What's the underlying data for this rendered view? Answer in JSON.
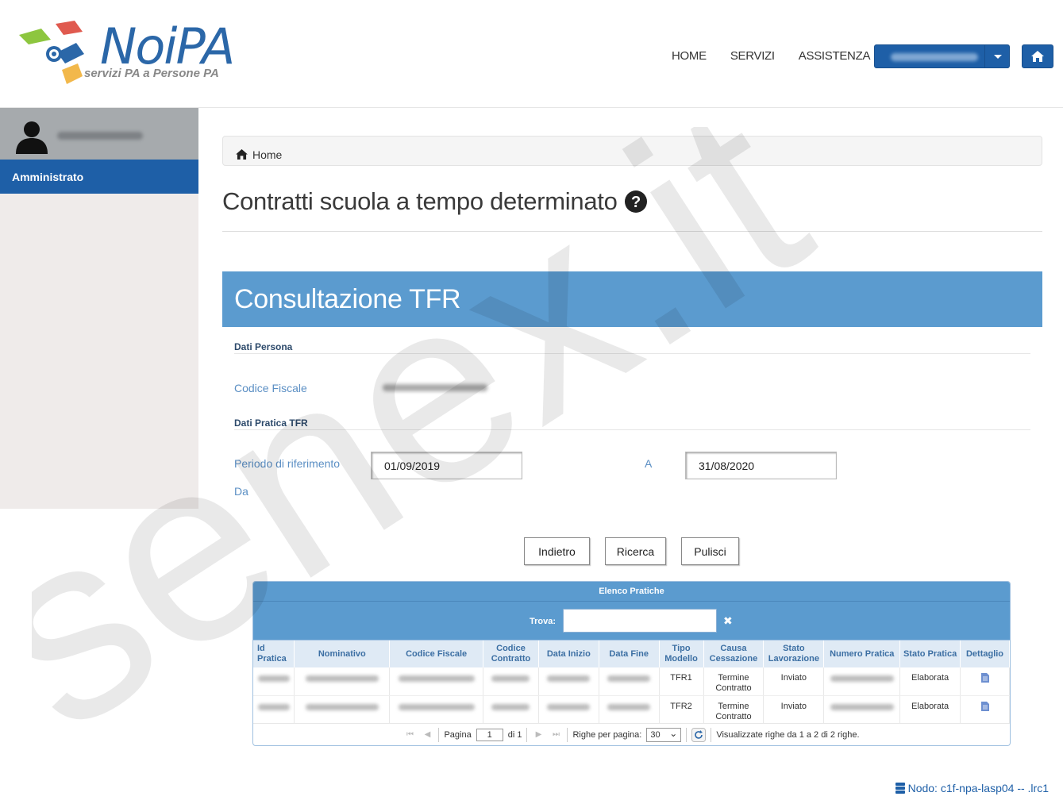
{
  "header": {
    "logo_text": "NoiPA",
    "logo_sub": "servizi PA a Persone PA",
    "nav": [
      "HOME",
      "SERVIZI",
      "ASSISTENZA"
    ]
  },
  "sidebar": {
    "item": "Amministrato"
  },
  "breadcrumb": "Home",
  "page_title": "Contratti scuola a tempo determinato",
  "panel_title": "Consultazione TFR",
  "sections": {
    "persona": "Dati Persona",
    "pratica": "Dati Pratica TFR"
  },
  "fields": {
    "codice_fiscale_label": "Codice Fiscale",
    "periodo_label": "Periodo di riferimento",
    "da_label": "Da",
    "a_label": "A",
    "date_from": "01/09/2019",
    "date_to": "31/08/2020"
  },
  "buttons": {
    "back": "Indietro",
    "search": "Ricerca",
    "clear": "Pulisci"
  },
  "grid": {
    "caption": "Elenco Pratiche",
    "find_label": "Trova:",
    "columns": [
      "Id Pratica",
      "Nominativo",
      "Codice Fiscale",
      "Codice Contratto",
      "Data Inizio",
      "Data Fine",
      "Tipo Modello",
      "Causa Cessazione",
      "Stato Lavorazione",
      "Numero Pratica",
      "Stato Pratica",
      "Dettaglio"
    ],
    "rows": [
      {
        "tipo_modello": "TFR1",
        "causa_cessazione": "Termine Contratto",
        "stato_lavorazione": "Inviato",
        "stato_pratica": "Elaborata"
      },
      {
        "tipo_modello": "TFR2",
        "causa_cessazione": "Termine Contratto",
        "stato_lavorazione": "Inviato",
        "stato_pratica": "Elaborata"
      }
    ],
    "pager": {
      "page_label": "Pagina",
      "page_value": "1",
      "of_label": "di 1",
      "rows_per_page_label": "Righe per pagina:",
      "rows_per_page_value": "30",
      "summary": "Visualizzate righe da 1 a 2 di 2 righe."
    }
  },
  "footer": "Nodo: c1f-npa-lasp04 -- .lrc1",
  "watermark": "senex.it",
  "colors": {
    "brand_blue": "#1e5fa7",
    "panel_blue": "#5b9bcf"
  }
}
